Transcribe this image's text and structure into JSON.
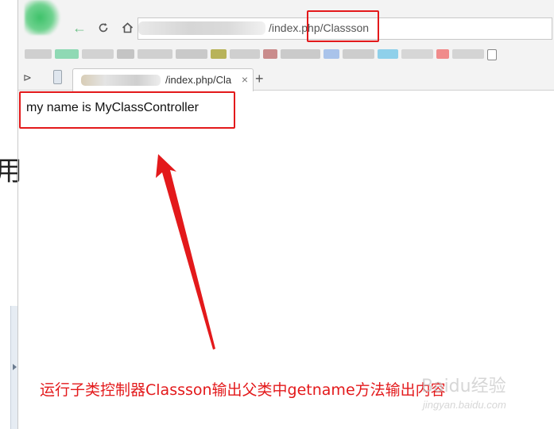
{
  "address_bar": {
    "url_visible": "/index.php/Classson"
  },
  "tab": {
    "title": "/index.php/Cla",
    "close": "×",
    "new_tab": "+"
  },
  "toolbar": {
    "back_icon": "arrow-left-icon",
    "reload_icon": "reload-icon",
    "home_icon": "home-icon"
  },
  "page": {
    "output_text": "my name is MyClassController"
  },
  "annotation": {
    "caption": "运行子类控制器Classson输出父类中getname方法输出内容",
    "color": "#e3191b"
  },
  "left_window": {
    "partial_char": "用"
  },
  "watermark": {
    "line1": "Baidu经验",
    "line2": "jingyan.baidu.com"
  },
  "colors": {
    "highlight": "#e3191b",
    "chrome_bg": "#f3f3f3"
  }
}
